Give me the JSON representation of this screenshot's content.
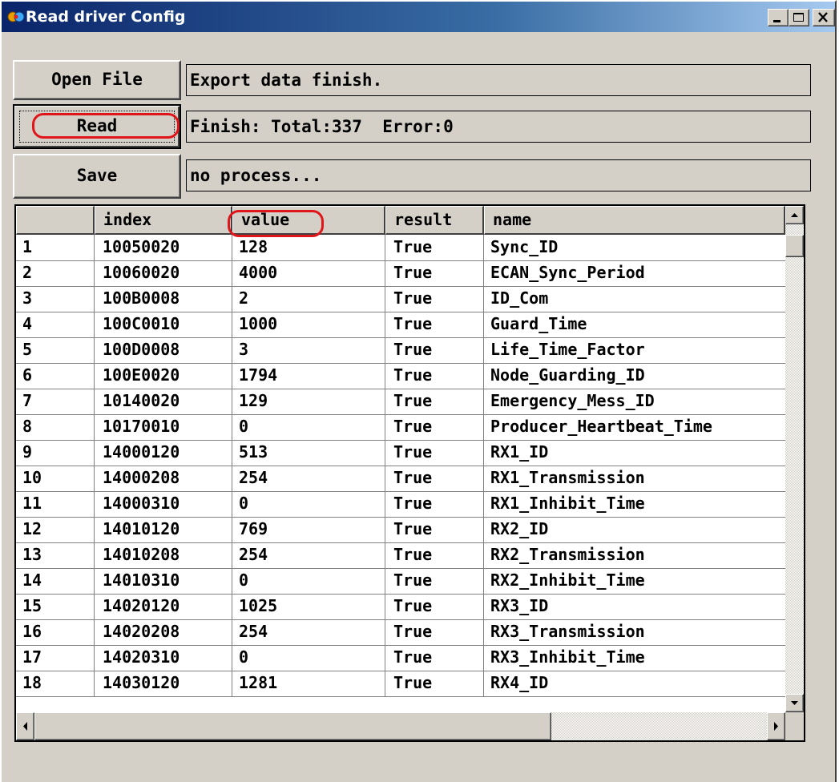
{
  "window": {
    "title": "Read driver Config"
  },
  "buttons": {
    "open_file": "Open File",
    "read": "Read",
    "save": "Save"
  },
  "status": {
    "open_file": "Export data finish.",
    "read": "Finish: Total:337  Error:0",
    "save": "no process..."
  },
  "table": {
    "headers": [
      "",
      "index",
      "value",
      "result",
      "name"
    ],
    "rows": [
      [
        "1",
        "10050020",
        "128",
        "True",
        "Sync_ID"
      ],
      [
        "2",
        "10060020",
        "4000",
        "True",
        "ECAN_Sync_Period"
      ],
      [
        "3",
        "100B0008",
        "2",
        "True",
        "ID_Com"
      ],
      [
        "4",
        "100C0010",
        "1000",
        "True",
        "Guard_Time"
      ],
      [
        "5",
        "100D0008",
        "3",
        "True",
        "Life_Time_Factor"
      ],
      [
        "6",
        "100E0020",
        "1794",
        "True",
        "Node_Guarding_ID"
      ],
      [
        "7",
        "10140020",
        "129",
        "True",
        "Emergency_Mess_ID"
      ],
      [
        "8",
        "10170010",
        "0",
        "True",
        "Producer_Heartbeat_Time"
      ],
      [
        "9",
        "14000120",
        "513",
        "True",
        "RX1_ID"
      ],
      [
        "10",
        "14000208",
        "254",
        "True",
        "RX1_Transmission"
      ],
      [
        "11",
        "14000310",
        "0",
        "True",
        "RX1_Inhibit_Time"
      ],
      [
        "12",
        "14010120",
        "769",
        "True",
        "RX2_ID"
      ],
      [
        "13",
        "14010208",
        "254",
        "True",
        "RX2_Transmission"
      ],
      [
        "14",
        "14010310",
        "0",
        "True",
        "RX2_Inhibit_Time"
      ],
      [
        "15",
        "14020120",
        "1025",
        "True",
        "RX3_ID"
      ],
      [
        "16",
        "14020208",
        "254",
        "True",
        "RX3_Transmission"
      ],
      [
        "17",
        "14020310",
        "0",
        "True",
        "RX3_Inhibit_Time"
      ],
      [
        "18",
        "14030120",
        "1281",
        "True",
        "RX4_ID"
      ]
    ]
  },
  "colors": {
    "window_bg": "#d4d0c8",
    "title_gradient_start": "#0a246a",
    "annotation_red": "#e0151a"
  },
  "icons": {
    "title": "app-icon",
    "minimize": "minimize-icon",
    "maximize": "maximize-icon",
    "close": "close-icon",
    "scroll_up": "arrow-up-icon",
    "scroll_down": "arrow-down-icon",
    "scroll_left": "arrow-left-icon",
    "scroll_right": "arrow-right-icon"
  }
}
